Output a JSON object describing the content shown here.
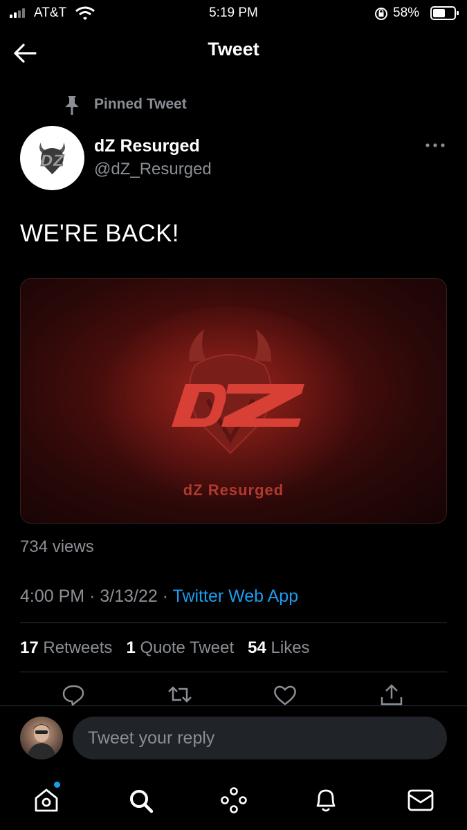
{
  "status_bar": {
    "carrier": "AT&T",
    "time": "5:19 PM",
    "battery": "58%"
  },
  "header": {
    "title": "Tweet"
  },
  "tweet": {
    "pinned_label": "Pinned Tweet",
    "author_name": "dZ Resurged",
    "author_handle": "@dZ_Resurged",
    "text": "WE'RE BACK!",
    "media_caption": "dZ Resurged",
    "views": "734 views",
    "time": "4:00 PM",
    "date": "3/13/22",
    "source": "Twitter Web App",
    "separator": "·",
    "stats": {
      "retweets_count": "17",
      "retweets_label": "Retweets",
      "quotes_count": "1",
      "quotes_label": "Quote Tweet",
      "likes_count": "54",
      "likes_label": "Likes"
    }
  },
  "reply": {
    "placeholder": "Tweet your reply"
  },
  "colors": {
    "accent": "#1d9bf0",
    "muted": "#8b8f94",
    "background": "#000000"
  },
  "icons": [
    "back-arrow-icon",
    "pin-icon",
    "more-icon",
    "reply-icon",
    "retweet-icon",
    "like-icon",
    "share-icon",
    "home-icon",
    "search-icon",
    "spaces-icon",
    "notifications-icon",
    "messages-icon"
  ]
}
